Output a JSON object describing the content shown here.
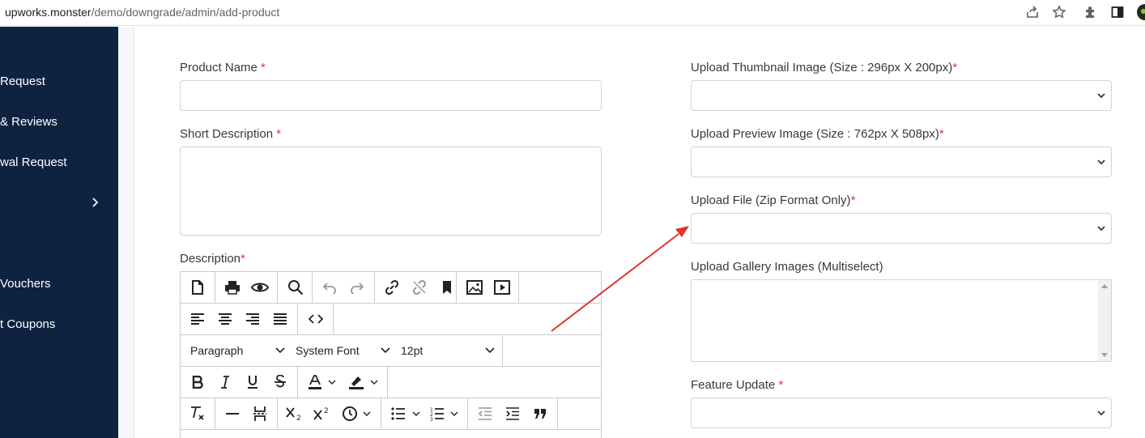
{
  "browser": {
    "url_host": "upworks.monster",
    "url_path": "/demo/downgrade/admin/add-product"
  },
  "sidebar": {
    "items": [
      {
        "label": "Request"
      },
      {
        "label": "& Reviews"
      },
      {
        "label": "wal Request"
      },
      {
        "label": "Vouchers"
      },
      {
        "label": "t Coupons"
      }
    ]
  },
  "form": {
    "product_name": {
      "label": "Product Name ",
      "required": "*",
      "value": ""
    },
    "short_description": {
      "label": "Short Description ",
      "required": "*",
      "value": ""
    },
    "description": {
      "label": "Description",
      "required": "*"
    },
    "thumbnail": {
      "label": "Upload Thumbnail Image (Size : 296px X 200px)",
      "required": "*"
    },
    "preview": {
      "label": "Upload Preview Image (Size : 762px X 508px)",
      "required": "*"
    },
    "file": {
      "label": "Upload File (Zip Format Only)",
      "required": "*"
    },
    "gallery": {
      "label": "Upload Gallery Images (Multiselect)"
    },
    "feature_update": {
      "label": "Feature Update ",
      "required": "*"
    }
  },
  "editor": {
    "block_format": "Paragraph",
    "font_family": "System Font",
    "font_size": "12pt"
  },
  "colors": {
    "sidebar_bg": "#0e2340",
    "required": "#dc3545",
    "annotation_arrow": "#e03131"
  }
}
